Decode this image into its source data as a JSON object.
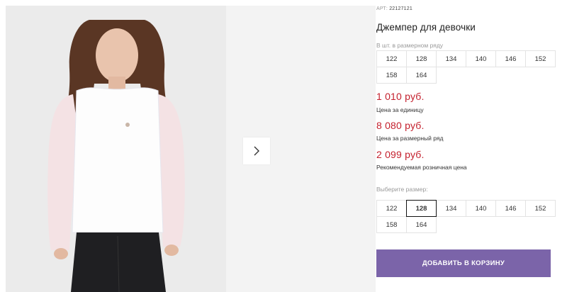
{
  "gallery": {
    "next_icon": "chevron-right-icon"
  },
  "product": {
    "article_label": "АРТ:",
    "article_value": "22127121",
    "title": "Джемпер для девочки"
  },
  "pack_sizes": {
    "label": "В шт. в размерном ряду",
    "sizes": [
      "122",
      "128",
      "134",
      "140",
      "146",
      "152",
      "158",
      "164"
    ]
  },
  "prices": [
    {
      "amount": "1 010 руб.",
      "caption": "Цена за единицу"
    },
    {
      "amount": "8 080 руб.",
      "caption": "Цена за размерный ряд"
    },
    {
      "amount": "2 099 руб.",
      "caption": "Рекомендуемая розничная цена"
    }
  ],
  "size_select": {
    "label": "Выберите размер:",
    "sizes": [
      "122",
      "128",
      "134",
      "140",
      "146",
      "152",
      "158",
      "164"
    ],
    "selected": "128"
  },
  "cart": {
    "add_label": "ДОБАВИТЬ В КОРЗИНУ"
  },
  "colors": {
    "price": "#c4202d",
    "button": "#7b64a9",
    "photo_bg": "#ebebeb"
  }
}
